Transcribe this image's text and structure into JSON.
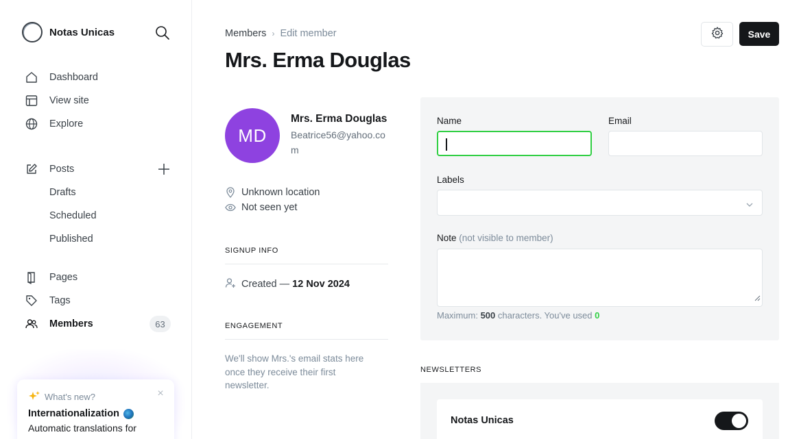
{
  "app": {
    "site_name": "Notas Unicas"
  },
  "sidebar": {
    "items": [
      {
        "label": "Dashboard",
        "icon": "home-icon"
      },
      {
        "label": "View site",
        "icon": "layout-icon"
      },
      {
        "label": "Explore",
        "icon": "globe-icon"
      },
      {
        "label": "Posts",
        "icon": "edit-icon"
      },
      {
        "label": "Drafts"
      },
      {
        "label": "Scheduled"
      },
      {
        "label": "Published"
      },
      {
        "label": "Pages",
        "icon": "page-icon"
      },
      {
        "label": "Tags",
        "icon": "tag-icon"
      },
      {
        "label": "Members",
        "icon": "members-icon",
        "count": "63",
        "active": true
      }
    ]
  },
  "whats_new": {
    "label": "What's new?",
    "title": "Internationalization",
    "description": "Automatic translations for"
  },
  "header": {
    "breadcrumb_parent": "Members",
    "breadcrumb_sep": "›",
    "breadcrumb_current": "Edit member",
    "title": "Mrs. Erma Douglas",
    "save_label": "Save"
  },
  "profile": {
    "initials": "MD",
    "name": "Mrs. Erma Douglas",
    "email": "Beatrice56@yahoo.com",
    "location": "Unknown location",
    "last_seen": "Not seen yet",
    "signup_title": "SIGNUP INFO",
    "created_prefix": "Created — ",
    "created_date": "12 Nov 2024",
    "engagement_title": "ENGAGEMENT",
    "engagement_text": "We'll show Mrs.'s email stats here once they receive their first newsletter."
  },
  "form": {
    "name_label": "Name",
    "name_value": "",
    "email_label": "Email",
    "email_value": "",
    "labels_label": "Labels",
    "note_label": "Note",
    "note_hint": "(not visible to member)",
    "counter_prefix": "Maximum: ",
    "counter_max": "500",
    "counter_middle": " characters. You've used ",
    "counter_used": "0"
  },
  "newsletters": {
    "section_title": "NEWSLETTERS",
    "items": [
      {
        "name": "Notas Unicas",
        "subscribed": true
      }
    ]
  },
  "colors": {
    "accent": "#30cf43",
    "avatar": "#8e42e0",
    "primary_button": "#15171a"
  }
}
